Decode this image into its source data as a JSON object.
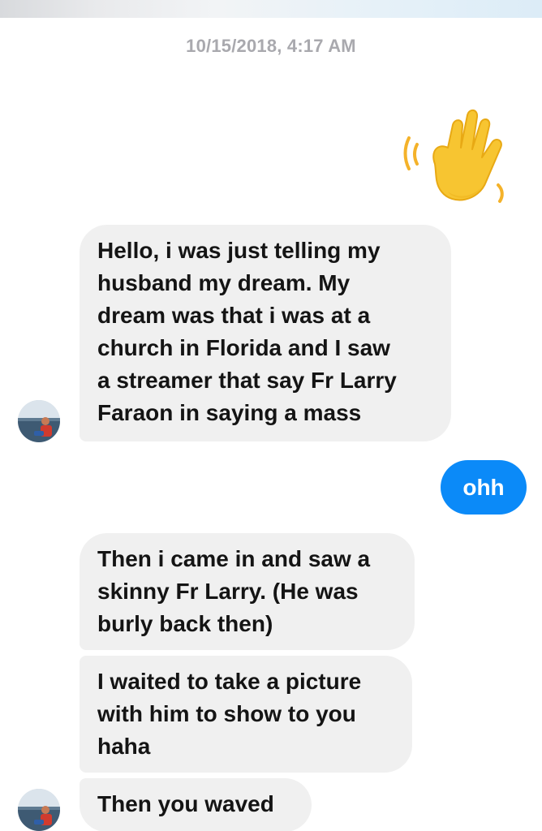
{
  "conversation": {
    "timestamp": "10/15/2018, 4:17 AM",
    "messages": [
      {
        "direction": "outgoing",
        "type": "emoji",
        "emoji": "waving-hand"
      },
      {
        "direction": "incoming",
        "lines": [
          "Hello, i was just telling my",
          "husband my dream. My",
          "dream was that i was at a",
          "church in Florida and I saw",
          "a streamer that say Fr Larry",
          "Faraon in saying a mass"
        ]
      },
      {
        "direction": "outgoing",
        "text": "ohh"
      },
      {
        "direction": "incoming",
        "lines": [
          "Then i came in and saw a",
          "skinny Fr Larry. (He was",
          "burly back then)"
        ]
      },
      {
        "direction": "incoming",
        "lines": [
          "I waited to take a picture",
          "with him to show to you",
          "haha"
        ]
      },
      {
        "direction": "incoming",
        "lines": [
          "Then you waved"
        ]
      }
    ]
  },
  "colors": {
    "incoming_bubble": "#f0f0f0",
    "outgoing_bubble": "#0b8af8",
    "timestamp_text": "#a9a9ae",
    "message_text": "#141414"
  },
  "icons": {
    "emoji": "waving-hand-emoji",
    "avatar": "contact-avatar"
  }
}
